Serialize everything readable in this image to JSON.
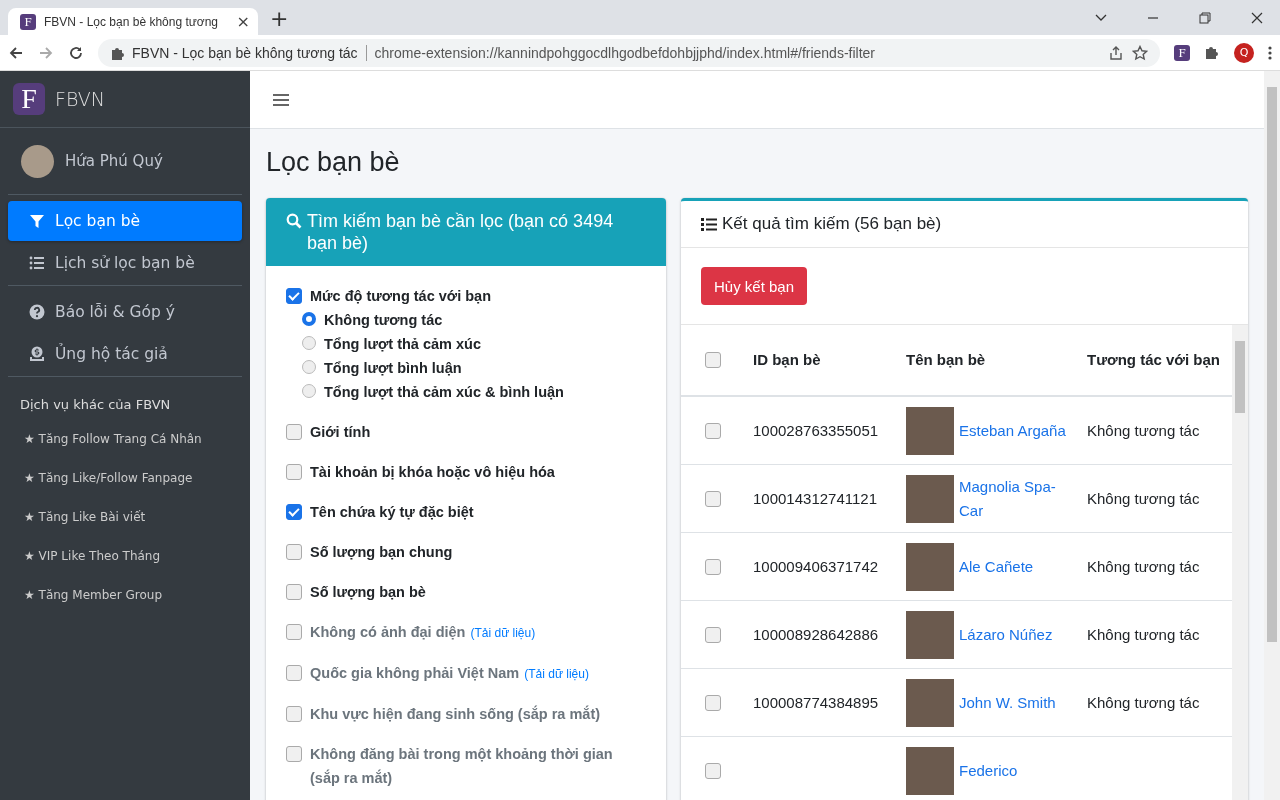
{
  "browser": {
    "tab_title": "FBVN - Lọc bạn bè không tương",
    "address_title": "FBVN - Lọc bạn bè không tương tác",
    "url": "chrome-extension://kannindpohggocdlhgodbefdohbjjphd/index.html#/friends-filter",
    "profile_initial": "Q",
    "favicon_letter": "F",
    "extension_letter": "F",
    "close_glyph": "×",
    "new_tab_glyph": "+"
  },
  "sidebar": {
    "logo_letter": "F",
    "brand": "FBVN",
    "user": "Hứa Phú Quý",
    "nav": [
      {
        "label": "Lọc bạn bè",
        "selected": true
      },
      {
        "label": "Lịch sử lọc bạn bè",
        "selected": false
      }
    ],
    "nav2": [
      {
        "label": "Báo lỗi & Góp ý",
        "selected": false
      },
      {
        "label": "Ủng hộ tác giả",
        "selected": false
      }
    ],
    "services_title": "Dịch vụ khác của FBVN",
    "services": [
      "★ Tăng Follow Trang Cá Nhân",
      "★ Tăng Like/Follow Fanpage",
      "★ Tăng Like Bài viết",
      "★ VIP Like Theo Tháng",
      "★ Tăng Member Group"
    ]
  },
  "page_title": "Lọc bạn bè",
  "filter_card": {
    "title": "Tìm kiếm bạn bè cần lọc (bạn có 3494 bạn bè)",
    "options": [
      {
        "kind": "checkbox",
        "label": "Mức độ tương tác với bạn",
        "checked": true,
        "disabled": false,
        "children": [
          {
            "kind": "radio",
            "label": "Không tương tác",
            "selected": true
          },
          {
            "kind": "radio",
            "label": "Tổng lượt thả cảm xúc",
            "selected": false
          },
          {
            "kind": "radio",
            "label": "Tổng lượt bình luận",
            "selected": false
          },
          {
            "kind": "radio",
            "label": "Tổng lượt thả cảm xúc & bình luận",
            "selected": false
          }
        ]
      },
      {
        "kind": "checkbox",
        "label": "Giới tính",
        "checked": false,
        "disabled": false
      },
      {
        "kind": "checkbox",
        "label": "Tài khoản bị khóa hoặc vô hiệu hóa",
        "checked": false,
        "disabled": false
      },
      {
        "kind": "checkbox",
        "label": "Tên chứa ký tự đặc biệt",
        "checked": true,
        "disabled": false
      },
      {
        "kind": "checkbox",
        "label": "Số lượng bạn chung",
        "checked": false,
        "disabled": false
      },
      {
        "kind": "checkbox",
        "label": "Số lượng bạn bè",
        "checked": false,
        "disabled": false
      },
      {
        "kind": "checkbox",
        "label": "Không có ảnh đại diện",
        "checked": false,
        "disabled": true,
        "link": "(Tải dữ liệu)"
      },
      {
        "kind": "checkbox",
        "label": "Quốc gia không phải Việt Nam",
        "checked": false,
        "disabled": true,
        "link": "(Tải dữ liệu)"
      },
      {
        "kind": "checkbox",
        "label": "Khu vực hiện đang sinh sống (sắp ra mắt)",
        "checked": false,
        "disabled": true
      },
      {
        "kind": "checkbox",
        "label": "Không đăng bài trong một khoảng thời gian (sắp ra mắt)",
        "checked": false,
        "disabled": true
      }
    ]
  },
  "results_card": {
    "title": "Kết quả tìm kiếm (56 bạn bè)",
    "unfriend_button": "Hủy kết bạn",
    "table": {
      "select_all_checked": false,
      "columns": [
        "ID bạn bè",
        "Tên bạn bè",
        "Tương tác với bạn"
      ],
      "rows": [
        {
          "checked": false,
          "id": "100028763355051",
          "name": "Esteban Argaña",
          "interaction": "Không tương tác"
        },
        {
          "checked": false,
          "id": "100014312741121",
          "name": "Magnolia Spa-Car",
          "interaction": "Không tương tác"
        },
        {
          "checked": false,
          "id": "100009406371742",
          "name": "Ale Cañete",
          "interaction": "Không tương tác"
        },
        {
          "checked": false,
          "id": "100008928642886",
          "name": "Lázaro Núñez",
          "interaction": "Không tương tác"
        },
        {
          "checked": false,
          "id": "100008774384895",
          "name": "John W. Smith",
          "interaction": "Không tương tác"
        },
        {
          "checked": false,
          "name": "Federico"
        }
      ]
    }
  }
}
